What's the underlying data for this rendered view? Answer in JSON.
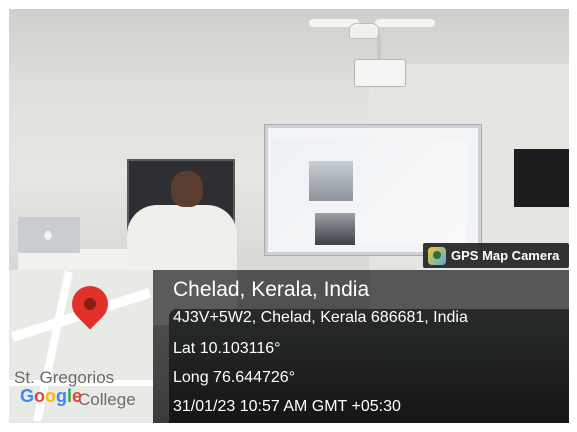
{
  "badge": {
    "label": "GPS Map Camera",
    "icon": "gps-map-camera-icon"
  },
  "map": {
    "place_label_line1": "St. Gregorios",
    "place_label_line2": "College",
    "google_letters": [
      "G",
      "o",
      "o",
      "g",
      "l",
      "e"
    ],
    "google_colors": [
      "#4285f4",
      "#ea4335",
      "#fbbc05",
      "#4285f4",
      "#34a853",
      "#ea4335"
    ],
    "pin_color": "#e2312a"
  },
  "location": {
    "title": "Chelad, Kerala, India",
    "address": "4J3V+5W2, Chelad, Kerala 686681, India",
    "lat": "Lat 10.103116°",
    "long": "Long 76.644726°",
    "timestamp": "31/01/23 10:57 AM GMT +05:30"
  }
}
